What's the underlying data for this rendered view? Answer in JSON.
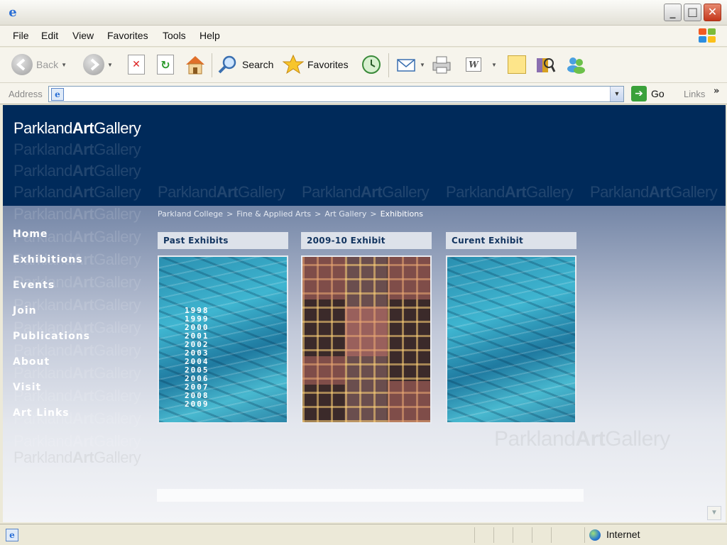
{
  "window": {
    "controls": {
      "minimize": "_",
      "maximize": "□",
      "close": "✕"
    }
  },
  "menu": [
    "File",
    "Edit",
    "View",
    "Favorites",
    "Tools",
    "Help"
  ],
  "toolbar": {
    "back": "Back",
    "search": "Search",
    "favorites": "Favorites"
  },
  "address": {
    "label": "Address",
    "value": "",
    "go": "Go",
    "links": "Links",
    "links_chevron": "»"
  },
  "site": {
    "logo": {
      "prefix": "Parkland",
      "bold": "Art",
      "suffix": "Gallery"
    },
    "breadcrumb": [
      "Parkland College",
      "Fine & Applied Arts",
      "Art Gallery"
    ],
    "breadcrumb_separator": ">",
    "breadcrumb_current": "Exhibitions",
    "nav": [
      "Home",
      "Exhibitions",
      "Events",
      "Join",
      "Publications",
      "About",
      "Visit",
      "Art Links"
    ],
    "panels": [
      {
        "title": "Past Exhibits"
      },
      {
        "title": "2009-10 Exhibit"
      },
      {
        "title": "Curent Exhibit"
      }
    ],
    "years": [
      "1998",
      "1999",
      "2000",
      "2001",
      "2002",
      "2003",
      "2004",
      "2005",
      "2006",
      "2007",
      "2008",
      "2009"
    ]
  },
  "status": {
    "zone": "Internet"
  },
  "colors": {
    "banner": "#002a5a",
    "panel_header_bg": "#dde2ea",
    "panel_header_text": "#12345f"
  }
}
